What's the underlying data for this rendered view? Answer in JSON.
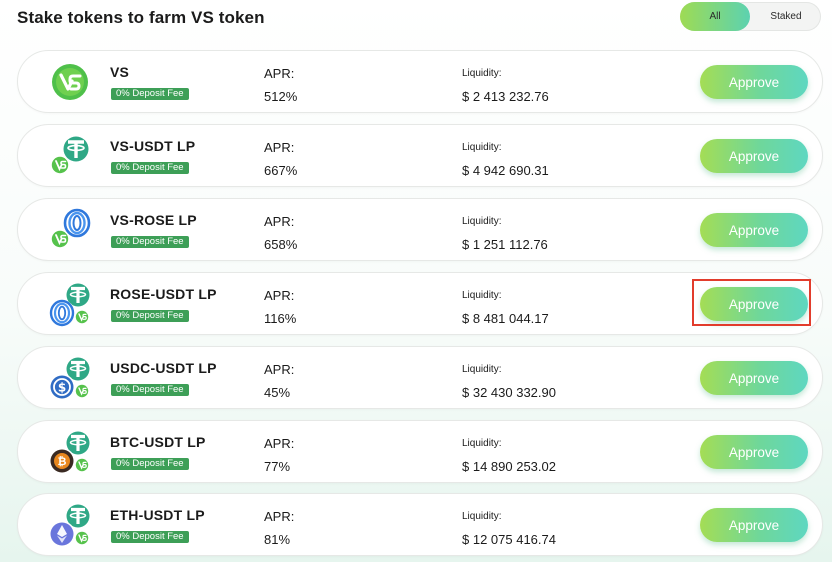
{
  "page": {
    "title": "Stake tokens to farm VS token",
    "filter": {
      "options": [
        "All",
        "Staked"
      ],
      "selected": "All"
    }
  },
  "farms": [
    {
      "name": "VS",
      "fee": "0% Deposit Fee",
      "apr_label": "APR:",
      "apr": "512%",
      "liquidity_label": "Liquidity:",
      "liquidity": "$ 2 413 232.76",
      "action": "Approve",
      "icons": [
        "vs-icon"
      ]
    },
    {
      "name": "VS-USDT LP",
      "fee": "0% Deposit Fee",
      "apr_label": "APR:",
      "apr": "667%",
      "liquidity_label": "Liquidity:",
      "liquidity": "$ 4 942 690.31",
      "action": "Approve",
      "icons": [
        "usdt-icon",
        "vs-icon"
      ]
    },
    {
      "name": "VS-ROSE LP",
      "fee": "0% Deposit Fee",
      "apr_label": "APR:",
      "apr": "658%",
      "liquidity_label": "Liquidity:",
      "liquidity": "$ 1 251 112.76",
      "action": "Approve",
      "icons": [
        "rose-icon",
        "vs-icon"
      ]
    },
    {
      "name": "ROSE-USDT LP",
      "fee": "0% Deposit Fee",
      "apr_label": "APR:",
      "apr": "116%",
      "liquidity_label": "Liquidity:",
      "liquidity": "$ 8 481 044.17",
      "action": "Approve",
      "icons": [
        "usdt-icon",
        "rose-icon",
        "vs-icon"
      ],
      "highlighted": true
    },
    {
      "name": "USDC-USDT LP",
      "fee": "0% Deposit Fee",
      "apr_label": "APR:",
      "apr": "45%",
      "liquidity_label": "Liquidity:",
      "liquidity": "$ 32 430 332.90",
      "action": "Approve",
      "icons": [
        "usdt-icon",
        "usdc-icon",
        "vs-icon"
      ]
    },
    {
      "name": "BTC-USDT LP",
      "fee": "0% Deposit Fee",
      "apr_label": "APR:",
      "apr": "77%",
      "liquidity_label": "Liquidity:",
      "liquidity": "$ 14 890 253.02",
      "action": "Approve",
      "icons": [
        "usdt-icon",
        "btc-icon",
        "vs-icon"
      ]
    },
    {
      "name": "ETH-USDT LP",
      "fee": "0% Deposit Fee",
      "apr_label": "APR:",
      "apr": "81%",
      "liquidity_label": "Liquidity:",
      "liquidity": "$ 12 075 416.74",
      "action": "Approve",
      "icons": [
        "usdt-icon",
        "eth-icon",
        "vs-icon"
      ]
    }
  ],
  "colors": {
    "brand_green": "#3d9f57",
    "button_gradient_start": "#a4dd55",
    "button_gradient_end": "#5ed7c1",
    "highlight_border": "#e23c2c",
    "usdt_teal": "#2fa886",
    "rose_blue": "#2f78dc",
    "usdc_blue": "#2f6cc4",
    "btc_orange": "#e8871e",
    "eth_purple": "#6a76dc"
  }
}
